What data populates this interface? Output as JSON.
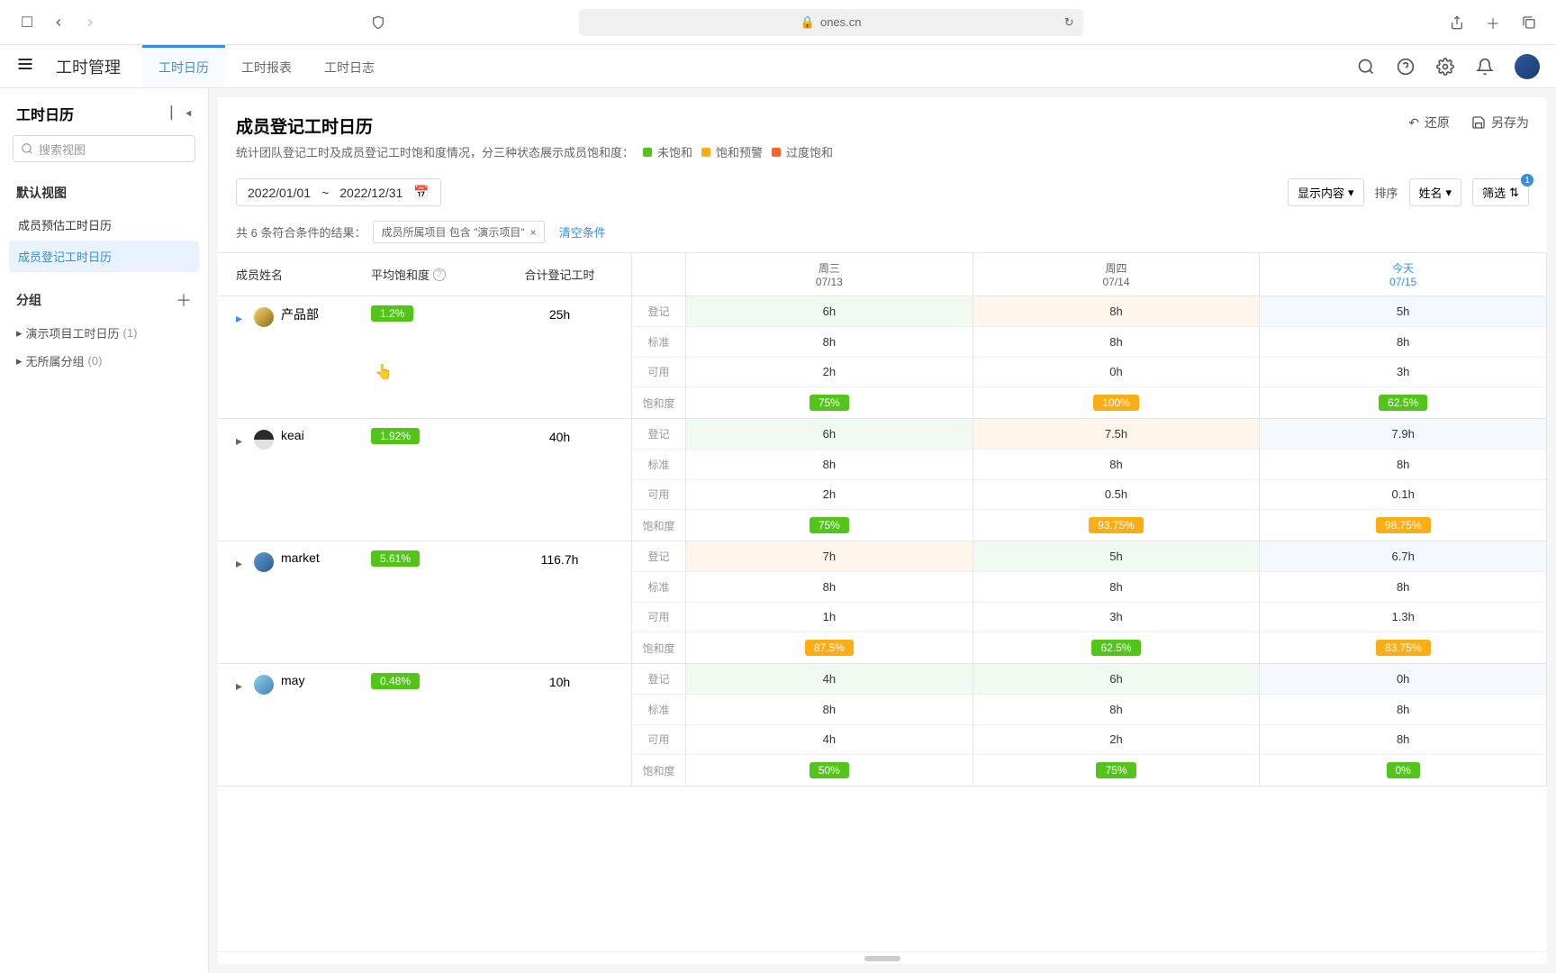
{
  "browser": {
    "url": "ones.cn"
  },
  "app": {
    "title": "工时管理",
    "tabs": [
      "工时日历",
      "工时报表",
      "工时日志"
    ],
    "active_tab": 0
  },
  "sidebar": {
    "title": "工时日历",
    "search_placeholder": "搜索视图",
    "default_view_label": "默认视图",
    "views": [
      "成员预估工时日历",
      "成员登记工时日历"
    ],
    "active_view": 1,
    "group_label": "分组",
    "groups": [
      {
        "name": "演示项目工时日历",
        "count": "(1)"
      },
      {
        "name": "无所属分组",
        "count": "(0)"
      }
    ]
  },
  "page": {
    "title": "成员登记工时日历",
    "subtitle": "统计团队登记工时及成员登记工时饱和度情况，分三种状态展示成员饱和度：",
    "legend": [
      "未饱和",
      "饱和预警",
      "过度饱和"
    ],
    "actions": {
      "reset": "还原",
      "save_as": "另存为"
    }
  },
  "toolbar": {
    "date_start": "2022/01/01",
    "date_sep": "~",
    "date_end": "2022/12/31",
    "display_btn": "显示内容",
    "sort_label": "排序",
    "sort_value": "姓名",
    "filter_btn": "筛选",
    "filter_count": "1"
  },
  "filter_bar": {
    "prefix": "共 6 条符合条件的结果：",
    "chip": "成员所属项目 包含 \"演示项目\"",
    "clear": "清空条件"
  },
  "columns": {
    "name": "成员姓名",
    "saturation": "平均饱和度",
    "total": "合计登记工时",
    "row_labels": [
      "登记",
      "标准",
      "可用",
      "饱和度"
    ]
  },
  "days": [
    {
      "weekday": "周三",
      "date": "07/13",
      "today": false
    },
    {
      "weekday": "周四",
      "date": "07/14",
      "today": false
    },
    {
      "weekday": "今天",
      "date": "07/15",
      "today": true
    }
  ],
  "members": [
    {
      "name": "产品部",
      "saturation": "1.2%",
      "total": "25h",
      "expanded": true,
      "data": [
        {
          "reg": "6h",
          "std": "8h",
          "avail": "2h",
          "sat": "75%",
          "sat_cls": "green",
          "reg_bg": "green"
        },
        {
          "reg": "8h",
          "std": "8h",
          "avail": "0h",
          "sat": "100%",
          "sat_cls": "orange",
          "reg_bg": "orange"
        },
        {
          "reg": "5h",
          "std": "8h",
          "avail": "3h",
          "sat": "62.5%",
          "sat_cls": "green",
          "reg_bg": "today"
        }
      ]
    },
    {
      "name": "keai",
      "saturation": "1.92%",
      "total": "40h",
      "expanded": false,
      "data": [
        {
          "reg": "6h",
          "std": "8h",
          "avail": "2h",
          "sat": "75%",
          "sat_cls": "green",
          "reg_bg": "green"
        },
        {
          "reg": "7.5h",
          "std": "8h",
          "avail": "0.5h",
          "sat": "93.75%",
          "sat_cls": "orange",
          "reg_bg": "orange"
        },
        {
          "reg": "7.9h",
          "std": "8h",
          "avail": "0.1h",
          "sat": "98.75%",
          "sat_cls": "orange",
          "reg_bg": "today"
        }
      ]
    },
    {
      "name": "market",
      "saturation": "5.61%",
      "total": "116.7h",
      "expanded": false,
      "data": [
        {
          "reg": "7h",
          "std": "8h",
          "avail": "1h",
          "sat": "87.5%",
          "sat_cls": "orange",
          "reg_bg": "orange"
        },
        {
          "reg": "5h",
          "std": "8h",
          "avail": "3h",
          "sat": "62.5%",
          "sat_cls": "green",
          "reg_bg": "green"
        },
        {
          "reg": "6.7h",
          "std": "8h",
          "avail": "1.3h",
          "sat": "83.75%",
          "sat_cls": "orange",
          "reg_bg": "today"
        }
      ]
    },
    {
      "name": "may",
      "saturation": "0.48%",
      "total": "10h",
      "expanded": false,
      "data": [
        {
          "reg": "4h",
          "std": "8h",
          "avail": "4h",
          "sat": "50%",
          "sat_cls": "green",
          "reg_bg": "green"
        },
        {
          "reg": "6h",
          "std": "8h",
          "avail": "2h",
          "sat": "75%",
          "sat_cls": "green",
          "reg_bg": "green"
        },
        {
          "reg": "0h",
          "std": "8h",
          "avail": "8h",
          "sat": "0%",
          "sat_cls": "green",
          "reg_bg": "today"
        }
      ]
    }
  ]
}
